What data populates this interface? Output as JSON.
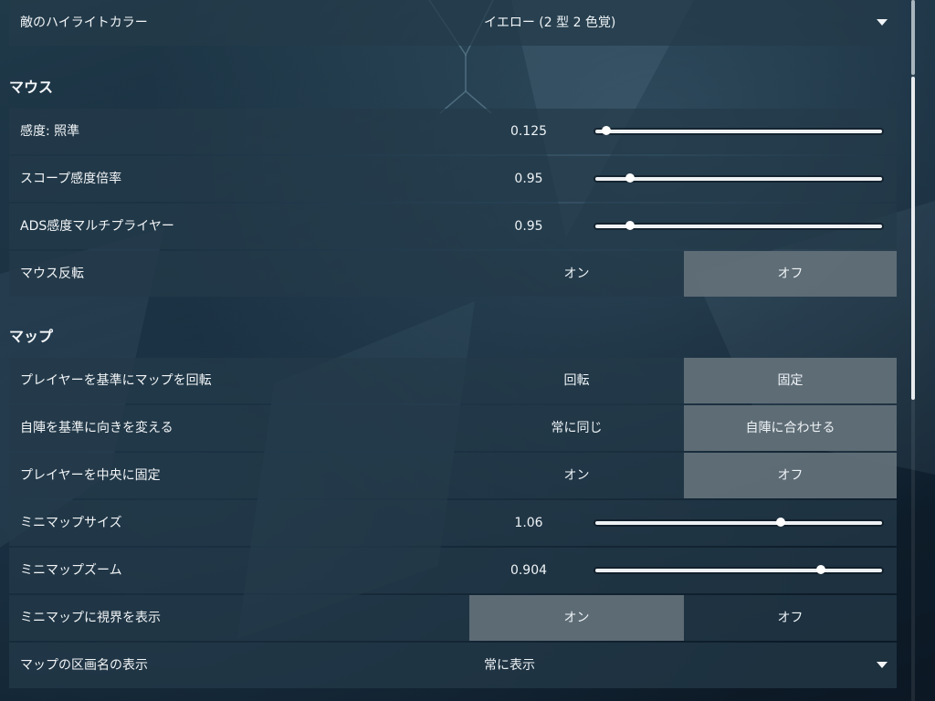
{
  "top_row": {
    "label": "敵のハイライトカラー",
    "value": "イエロー (2 型 2 色覚)"
  },
  "sections": {
    "mouse": "マウス",
    "map": "マップ"
  },
  "mouse": {
    "sensitivity": {
      "label": "感度: 照準",
      "value": "0.125",
      "fraction": 0.0
    },
    "scope_multiplier": {
      "label": "スコープ感度倍率",
      "value": "0.95",
      "fraction": 0.09
    },
    "ads_multiplier": {
      "label": "ADS感度マルチプライヤー",
      "value": "0.95",
      "fraction": 0.09
    },
    "invert": {
      "label": "マウス反転",
      "on": "オン",
      "off": "オフ",
      "selected": "off"
    }
  },
  "map": {
    "rotate": {
      "label": "プレイヤーを基準にマップを回転",
      "left": "回転",
      "right": "固定",
      "selected": "right"
    },
    "orientation": {
      "label": "自陣を基準に向きを変える",
      "left": "常に同じ",
      "right": "自陣に合わせる",
      "selected": "right"
    },
    "keep_centered": {
      "label": "プレイヤーを中央に固定",
      "left": "オン",
      "right": "オフ",
      "selected": "right"
    },
    "minimap_size": {
      "label": "ミニマップサイズ",
      "value": "1.06",
      "fraction": 0.66
    },
    "minimap_zoom": {
      "label": "ミニマップズーム",
      "value": "0.904",
      "fraction": 0.81
    },
    "vision_cones": {
      "label": "ミニマップに視界を表示",
      "left": "オン",
      "right": "オフ",
      "selected": "left"
    },
    "region_names": {
      "label": "マップの区画名の表示",
      "value": "常に表示"
    }
  },
  "icons": {
    "dropdown": "chevron-down-icon"
  },
  "colors": {
    "selected_toggle": "#69767e",
    "row_bg": "#243a4a",
    "slider": "#eef1f3"
  }
}
